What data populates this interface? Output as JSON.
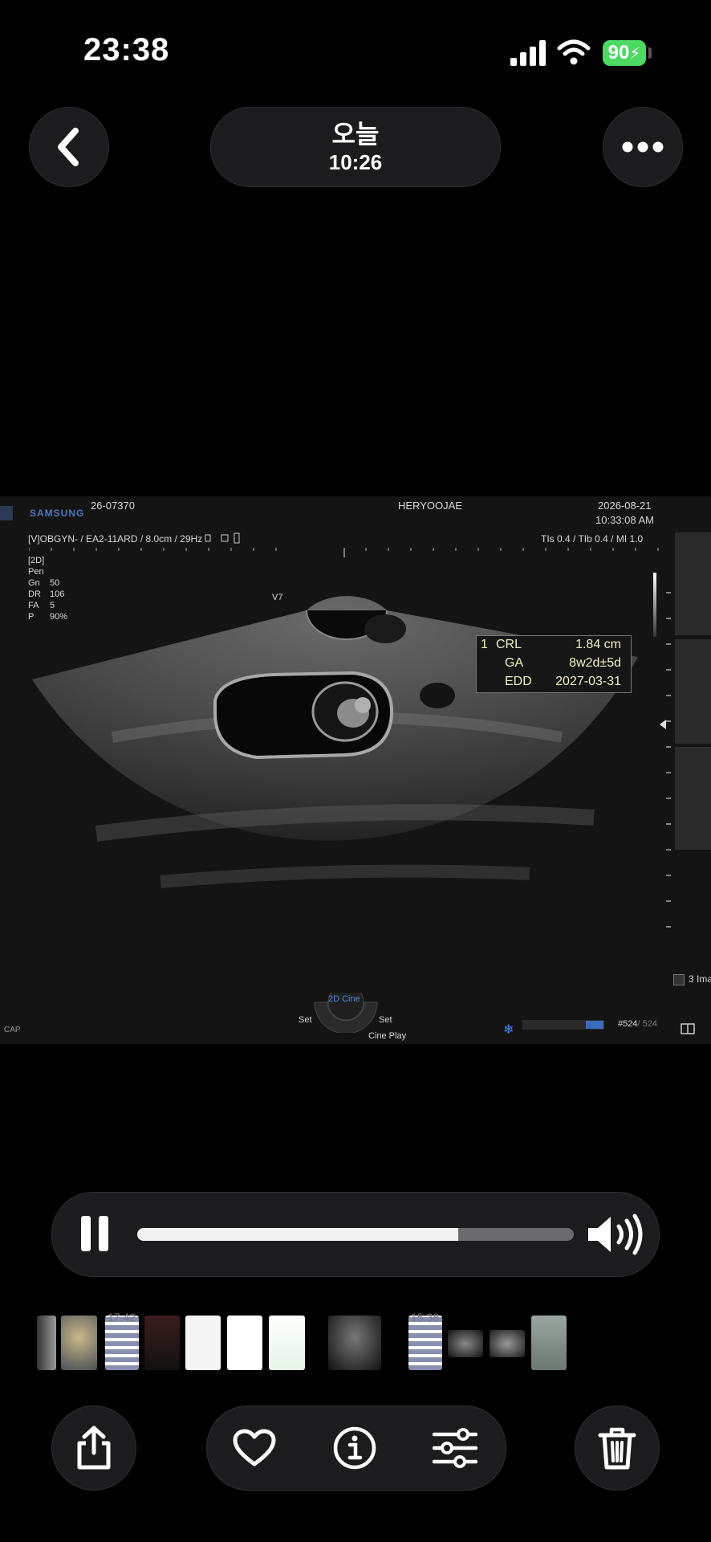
{
  "status_bar": {
    "time": "23:38",
    "battery": "90"
  },
  "header": {
    "title": "오늘",
    "subtitle": "10:26"
  },
  "ultrasound": {
    "brand": "SAMSUNG",
    "patient_id": "26-07370",
    "patient_name": "HERYOOJAE",
    "date": "2026-08-21",
    "time": "10:33:08 AM",
    "preset": "[V]OBGYN- / EA2-11ARD / 8.0cm / 29Hz",
    "thermal": "TIs  0.4 / TIb  0.4 / MI    1.0",
    "params": [
      {
        "label": "[2D]",
        "value": ""
      },
      {
        "label": "Pen",
        "value": ""
      },
      {
        "label": "Gn",
        "value": "50"
      },
      {
        "label": "DR",
        "value": "106"
      },
      {
        "label": "FA",
        "value": "5"
      },
      {
        "label": "P",
        "value": "90%"
      }
    ],
    "probe_label": "V7",
    "measurements": [
      {
        "index": "1",
        "label": "CRL",
        "value": "1.84 cm"
      },
      {
        "index": "",
        "label": "GA",
        "value": "8w2d±5d"
      },
      {
        "index": "",
        "label": "EDD",
        "value": "2027-03-31"
      }
    ],
    "cine_mode": "2D Cine",
    "set_left": "Set",
    "set_right": "Set",
    "cine_play": "Cine Play",
    "cap": "CAP",
    "frame_current": "#524",
    "frame_total": "/ 524",
    "images_label": "3 Ima"
  },
  "player": {
    "progress": 0.735
  },
  "thumbnails": {
    "timestamp_a": "17:42",
    "timestamp_b": "15:38"
  },
  "icons": {
    "back": "chevron-left-icon",
    "more": "ellipsis-icon",
    "pause": "pause-icon",
    "volume": "speaker-icon",
    "share": "share-icon",
    "favorite": "heart-icon",
    "info": "info-icon",
    "adjust": "sliders-icon",
    "delete": "trash-icon"
  },
  "colors": {
    "accent_green": "#4cd964",
    "pill_bg": "#1c1c1e",
    "measure_text": "#f1f1c0",
    "brand_blue": "#4a78c0"
  }
}
